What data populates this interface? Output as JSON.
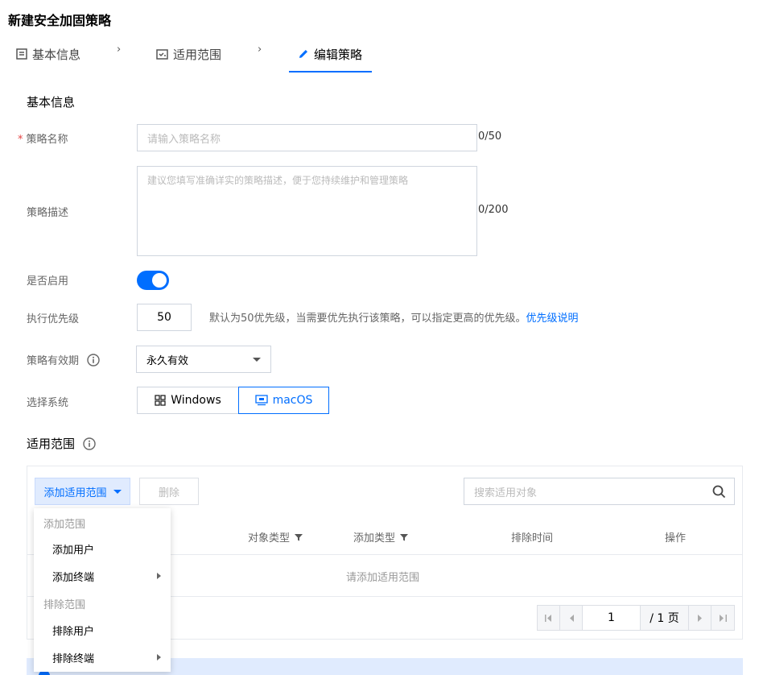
{
  "page_title": "新建安全加固策略",
  "steps": [
    {
      "label": "基本信息",
      "icon": "document-icon"
    },
    {
      "label": "适用范围",
      "icon": "scope-icon"
    },
    {
      "label": "编辑策略",
      "icon": "pencil-icon"
    }
  ],
  "chevron": "›",
  "basic_section": {
    "title": "基本信息"
  },
  "form": {
    "name": {
      "label": "策略名称",
      "required_mark": "*",
      "placeholder": "请输入策略名称",
      "counter": "0/50"
    },
    "description": {
      "label": "策略描述",
      "placeholder": "建议您填写准确详实的策略描述，便于您持续维护和管理策略",
      "counter": "0/200"
    },
    "enable": {
      "label": "是否启用",
      "value": true
    },
    "priority": {
      "label": "执行优先级",
      "value": "50",
      "hint": "默认为50优先级，当需要优先执行该策略，可以指定更高的优先级。",
      "link": "优先级说明"
    },
    "validity": {
      "label": "策略有效期",
      "value": "永久有效"
    },
    "system": {
      "label": "选择系统",
      "options": [
        "Windows",
        "macOS"
      ],
      "selected": "macOS"
    }
  },
  "scope_section": {
    "title": "适用范围"
  },
  "scope_toolbar": {
    "add_label": "添加适用范围",
    "delete_label": "删除",
    "search_placeholder": "搜索适用对象"
  },
  "table": {
    "columns": [
      "对象类型",
      "添加类型",
      "排除时间",
      "操作"
    ],
    "empty_text": "请添加适用范围"
  },
  "pager": {
    "current": "1",
    "total": "/ 1 页"
  },
  "dropdown": {
    "group_add": "添加范围",
    "add_user": "添加用户",
    "add_terminal": "添加终端",
    "group_exclude": "排除范围",
    "exclude_user": "排除用户",
    "exclude_terminal": "排除终端"
  },
  "colors": {
    "accent": "#006eff",
    "required": "#e54545",
    "light_accent": "#e0ebfe"
  }
}
